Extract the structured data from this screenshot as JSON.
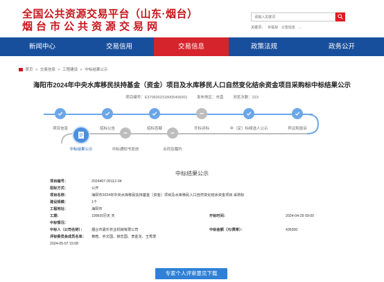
{
  "header": {
    "title_line1": "全国公共资源交易平台（山东·烟台）",
    "title_line2": "烟台市公共资源交易网",
    "search_placeholder": "请输入关键词",
    "hot_words": [
      "关键词：",
      "补贴标",
      "公告信息",
      "…"
    ]
  },
  "nav": {
    "items": [
      {
        "label": "新闻中心",
        "active": false
      },
      {
        "label": "交易信用",
        "active": false
      },
      {
        "label": "交易信息",
        "active": true
      },
      {
        "label": "政策法规",
        "active": false
      },
      {
        "label": "政务公开",
        "active": false
      }
    ]
  },
  "breadcrumb": [
    "首页",
    "交易信息",
    "工程建设",
    "中标结果公示"
  ],
  "project": {
    "title": "海阳市2024年中央水库移民扶持基金（资金）项目及水库移民人口自然变化结余资金项目采购标中标结果公示",
    "code_label": "项目编号：",
    "code": "E3706002318005406001",
    "region_label": "发布地区：",
    "region": "市直",
    "views_label": "浏览次数：",
    "views": "223"
  },
  "timeline": {
    "row1": [
      {
        "label": "项目信息",
        "state": "done"
      },
      {
        "label": "招标公告",
        "state": "done"
      },
      {
        "label": "招标答疑",
        "state": "done"
      },
      {
        "label": "开标评标",
        "state": "pending"
      },
      {
        "label": "中（定）标候选人公示",
        "state": "done"
      },
      {
        "label": "异议和投诉",
        "state": "done"
      }
    ],
    "row2": [
      {
        "label": "中标结果公示",
        "state": "current"
      },
      {
        "label": "中标通知书发放",
        "state": "pending"
      },
      {
        "label": "合同及履约",
        "state": "pending"
      }
    ]
  },
  "notice": {
    "heading": "中标结果公示",
    "fields": [
      {
        "label": "项目编号：",
        "value": "2024407-00112-04"
      },
      {
        "label": "招标方式：",
        "value": "公开"
      },
      {
        "label": "项目名称：",
        "value": "海阳市2024年中央水库移民扶持基金（资金）项目及水库移民人口自然变化结余资金项目 采购标"
      },
      {
        "label": "建设规模：",
        "value": "1个"
      },
      {
        "label": "工程地址：",
        "value": "海阳市"
      },
      {
        "label": "工期：",
        "value": "1996日历天 天",
        "label2": "开标时间：",
        "value2": "2024-04-29 09:00"
      },
      {
        "label": "中标情况：",
        "value": ""
      },
      {
        "label": "中标人（公司名称）：",
        "value": "烟台市嘉乐农业机械有限公司",
        "label2": "中标金额（元/费率）：",
        "value2": "436300"
      },
      {
        "label": "评标委员会成员名单：",
        "value": "黄皓、乔文国、柳志国、李金龙、王秀爱"
      },
      {
        "label": "",
        "value": "2024-05-07 15:08"
      }
    ],
    "download_label": "专家个人评审意见下载"
  },
  "colors": {
    "brand_red": "#c8161d",
    "nav_blue": "#184f9c",
    "nav_active": "#d6242c",
    "timeline_blue": "#6aa6e8",
    "button_blue": "#2f80d6"
  }
}
